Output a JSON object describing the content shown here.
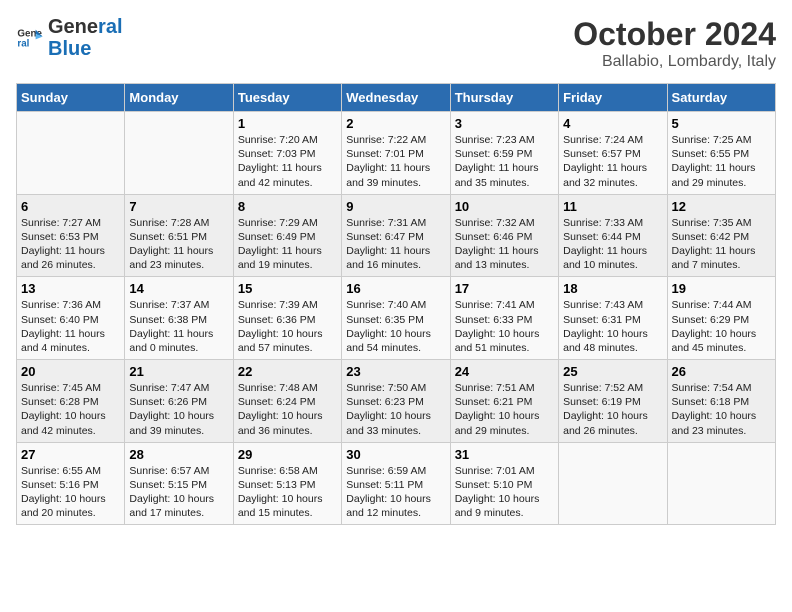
{
  "header": {
    "logo_general": "General",
    "logo_blue": "Blue",
    "month": "October 2024",
    "location": "Ballabio, Lombardy, Italy"
  },
  "days_of_week": [
    "Sunday",
    "Monday",
    "Tuesday",
    "Wednesday",
    "Thursday",
    "Friday",
    "Saturday"
  ],
  "weeks": [
    [
      {
        "num": "",
        "info": ""
      },
      {
        "num": "",
        "info": ""
      },
      {
        "num": "1",
        "info": "Sunrise: 7:20 AM\nSunset: 7:03 PM\nDaylight: 11 hours and 42 minutes."
      },
      {
        "num": "2",
        "info": "Sunrise: 7:22 AM\nSunset: 7:01 PM\nDaylight: 11 hours and 39 minutes."
      },
      {
        "num": "3",
        "info": "Sunrise: 7:23 AM\nSunset: 6:59 PM\nDaylight: 11 hours and 35 minutes."
      },
      {
        "num": "4",
        "info": "Sunrise: 7:24 AM\nSunset: 6:57 PM\nDaylight: 11 hours and 32 minutes."
      },
      {
        "num": "5",
        "info": "Sunrise: 7:25 AM\nSunset: 6:55 PM\nDaylight: 11 hours and 29 minutes."
      }
    ],
    [
      {
        "num": "6",
        "info": "Sunrise: 7:27 AM\nSunset: 6:53 PM\nDaylight: 11 hours and 26 minutes."
      },
      {
        "num": "7",
        "info": "Sunrise: 7:28 AM\nSunset: 6:51 PM\nDaylight: 11 hours and 23 minutes."
      },
      {
        "num": "8",
        "info": "Sunrise: 7:29 AM\nSunset: 6:49 PM\nDaylight: 11 hours and 19 minutes."
      },
      {
        "num": "9",
        "info": "Sunrise: 7:31 AM\nSunset: 6:47 PM\nDaylight: 11 hours and 16 minutes."
      },
      {
        "num": "10",
        "info": "Sunrise: 7:32 AM\nSunset: 6:46 PM\nDaylight: 11 hours and 13 minutes."
      },
      {
        "num": "11",
        "info": "Sunrise: 7:33 AM\nSunset: 6:44 PM\nDaylight: 11 hours and 10 minutes."
      },
      {
        "num": "12",
        "info": "Sunrise: 7:35 AM\nSunset: 6:42 PM\nDaylight: 11 hours and 7 minutes."
      }
    ],
    [
      {
        "num": "13",
        "info": "Sunrise: 7:36 AM\nSunset: 6:40 PM\nDaylight: 11 hours and 4 minutes."
      },
      {
        "num": "14",
        "info": "Sunrise: 7:37 AM\nSunset: 6:38 PM\nDaylight: 11 hours and 0 minutes."
      },
      {
        "num": "15",
        "info": "Sunrise: 7:39 AM\nSunset: 6:36 PM\nDaylight: 10 hours and 57 minutes."
      },
      {
        "num": "16",
        "info": "Sunrise: 7:40 AM\nSunset: 6:35 PM\nDaylight: 10 hours and 54 minutes."
      },
      {
        "num": "17",
        "info": "Sunrise: 7:41 AM\nSunset: 6:33 PM\nDaylight: 10 hours and 51 minutes."
      },
      {
        "num": "18",
        "info": "Sunrise: 7:43 AM\nSunset: 6:31 PM\nDaylight: 10 hours and 48 minutes."
      },
      {
        "num": "19",
        "info": "Sunrise: 7:44 AM\nSunset: 6:29 PM\nDaylight: 10 hours and 45 minutes."
      }
    ],
    [
      {
        "num": "20",
        "info": "Sunrise: 7:45 AM\nSunset: 6:28 PM\nDaylight: 10 hours and 42 minutes."
      },
      {
        "num": "21",
        "info": "Sunrise: 7:47 AM\nSunset: 6:26 PM\nDaylight: 10 hours and 39 minutes."
      },
      {
        "num": "22",
        "info": "Sunrise: 7:48 AM\nSunset: 6:24 PM\nDaylight: 10 hours and 36 minutes."
      },
      {
        "num": "23",
        "info": "Sunrise: 7:50 AM\nSunset: 6:23 PM\nDaylight: 10 hours and 33 minutes."
      },
      {
        "num": "24",
        "info": "Sunrise: 7:51 AM\nSunset: 6:21 PM\nDaylight: 10 hours and 29 minutes."
      },
      {
        "num": "25",
        "info": "Sunrise: 7:52 AM\nSunset: 6:19 PM\nDaylight: 10 hours and 26 minutes."
      },
      {
        "num": "26",
        "info": "Sunrise: 7:54 AM\nSunset: 6:18 PM\nDaylight: 10 hours and 23 minutes."
      }
    ],
    [
      {
        "num": "27",
        "info": "Sunrise: 6:55 AM\nSunset: 5:16 PM\nDaylight: 10 hours and 20 minutes."
      },
      {
        "num": "28",
        "info": "Sunrise: 6:57 AM\nSunset: 5:15 PM\nDaylight: 10 hours and 17 minutes."
      },
      {
        "num": "29",
        "info": "Sunrise: 6:58 AM\nSunset: 5:13 PM\nDaylight: 10 hours and 15 minutes."
      },
      {
        "num": "30",
        "info": "Sunrise: 6:59 AM\nSunset: 5:11 PM\nDaylight: 10 hours and 12 minutes."
      },
      {
        "num": "31",
        "info": "Sunrise: 7:01 AM\nSunset: 5:10 PM\nDaylight: 10 hours and 9 minutes."
      },
      {
        "num": "",
        "info": ""
      },
      {
        "num": "",
        "info": ""
      }
    ]
  ]
}
